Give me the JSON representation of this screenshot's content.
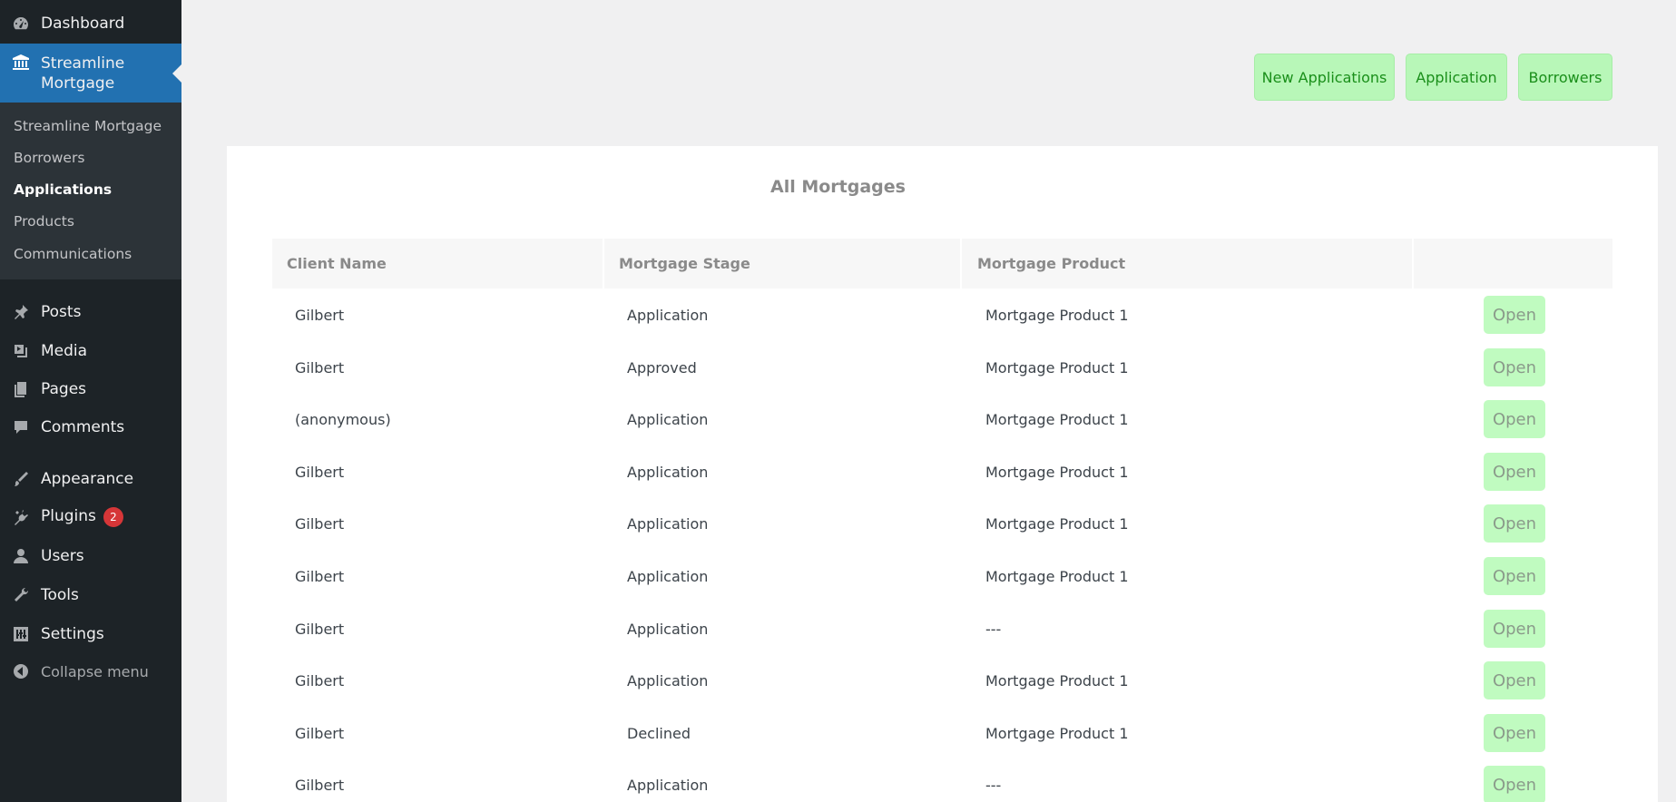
{
  "sidebar": {
    "dashboard": "Dashboard",
    "current_section": "Streamline Mortgage",
    "submenu": [
      "Streamline Mortgage",
      "Borrowers",
      "Applications",
      "Products",
      "Communications"
    ],
    "posts": "Posts",
    "media": "Media",
    "pages": "Pages",
    "comments": "Comments",
    "appearance": "Appearance",
    "plugins": "Plugins",
    "plugins_badge": "2",
    "users": "Users",
    "tools": "Tools",
    "settings": "Settings",
    "collapse": "Collapse menu"
  },
  "top_buttons": [
    "New Applications",
    "Application",
    "Borrowers"
  ],
  "card": {
    "title": "All Mortgages",
    "columns": [
      "Client Name",
      "Mortgage Stage",
      "Mortgage Product",
      ""
    ],
    "open_label": "Open",
    "rows": [
      [
        "Gilbert",
        "Application",
        "Mortgage Product 1"
      ],
      [
        "Gilbert",
        "Approved",
        "Mortgage Product 1"
      ],
      [
        "(anonymous)",
        "Application",
        "Mortgage Product 1"
      ],
      [
        "Gilbert",
        "Application",
        "Mortgage Product 1"
      ],
      [
        "Gilbert",
        "Application",
        "Mortgage Product 1"
      ],
      [
        "Gilbert",
        "Application",
        "Mortgage Product 1"
      ],
      [
        "Gilbert",
        "Application",
        "---"
      ],
      [
        "Gilbert",
        "Application",
        "Mortgage Product 1"
      ],
      [
        "Gilbert",
        "Declined",
        "Mortgage Product 1"
      ],
      [
        "Gilbert",
        "Application",
        "---"
      ]
    ]
  },
  "colors": {
    "sidebar_bg": "#1d2327",
    "submenu_bg": "#2c3338",
    "accent": "#2271b1",
    "button_green": "#b8f7b8",
    "button_text": "#1a8f1a"
  }
}
